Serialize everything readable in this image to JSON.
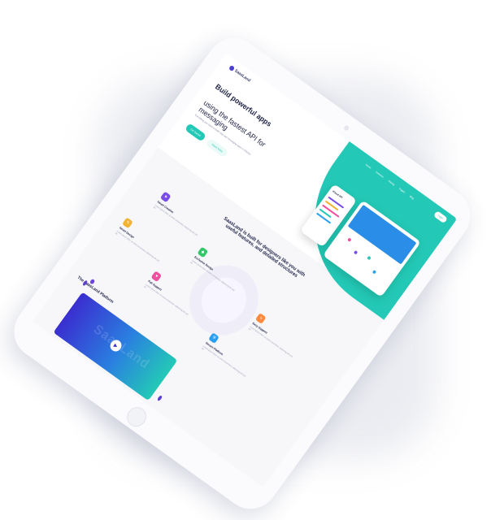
{
  "colors": {
    "accent": "#23c9b6",
    "brand": "#4a3fd3",
    "dark_text": "#1f2346",
    "video_gradient_start": "#3a2ed0",
    "video_gradient_end": "#23c9b6"
  },
  "header": {
    "logo_text": "SaasLand",
    "nav": [
      "Home",
      "Features",
      "Pricing",
      "Pages",
      "Blog"
    ],
    "nav_button": "Login"
  },
  "hero": {
    "title": "Build powerful apps",
    "subtitle": "using the fastest API for messaging",
    "description": "Everything you need to build chat and messaging apps in minutes.",
    "primary_button": "Get Started",
    "secondary_button": "Watch Video",
    "phone_label": "iCloud API"
  },
  "features": {
    "title": "SaasLand is built for designers like you with useful features, and detailed structures",
    "items": [
      {
        "name": "Smart Creative",
        "icon": "star-icon",
        "color": "#7b4de8"
      },
      {
        "name": "Smart Design",
        "icon": "pen-icon",
        "color": "#f2b233"
      },
      {
        "name": "Exclusive Design",
        "icon": "diamond-icon",
        "color": "#34c76a"
      },
      {
        "name": "Full Support",
        "icon": "heart-icon",
        "color": "#f04fa0"
      },
      {
        "name": "Easy Support",
        "icon": "bolt-icon",
        "color": "#ff8a3d"
      },
      {
        "name": "Secure Platform",
        "icon": "shield-icon",
        "color": "#2a9ff0"
      }
    ],
    "text": "Lorem ipsum dolor sit amet consectetur adipiscing elit sed do"
  },
  "platform": {
    "title": "The SaasLand Platform",
    "video_word": "SaasLand",
    "play_icon": "play-icon"
  }
}
